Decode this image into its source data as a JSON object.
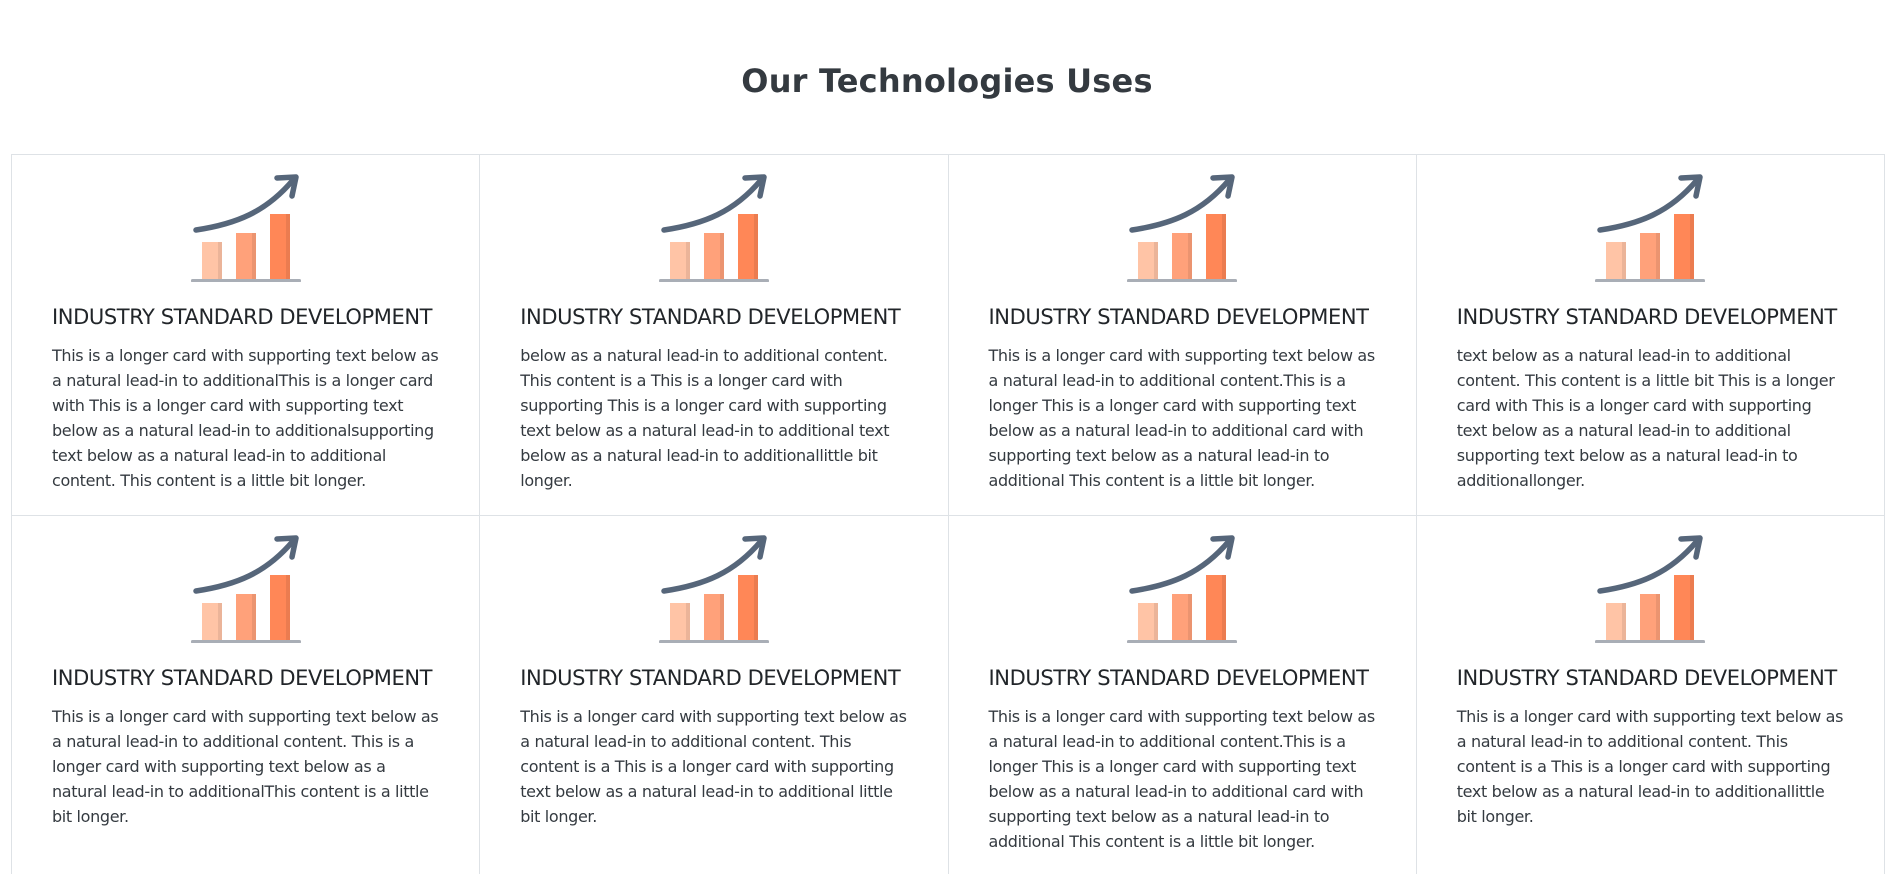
{
  "section": {
    "title": "Our Technologies Uses"
  },
  "icon": {
    "name": "growth-chart-icon",
    "arrow_color": "#56667a",
    "bar_colors": [
      "#ffc4a6",
      "#ffa17a",
      "#ff8757"
    ],
    "base_color": "#a9aeb6"
  },
  "cards": [
    {
      "title": "INDUSTRY STANDARD DEVELOPMENT",
      "text": "This is a longer card with supporting text below as a natural lead-in to additionalThis is a longer card with This is a longer card with supporting text below as a natural lead-in to additionalsupporting text below as a natural lead-in to additional content. This content is a little bit longer."
    },
    {
      "title": "INDUSTRY STANDARD DEVELOPMENT",
      "text": "below as a natural lead-in to additional content. This content is a This is a longer card with supporting This is a longer card with supporting text below as a natural lead-in to additional text below as a natural lead-in to additionallittle bit longer."
    },
    {
      "title": "INDUSTRY STANDARD DEVELOPMENT",
      "text": "This is a longer card with supporting text below as a natural lead-in to additional content.This is a longer This is a longer card with supporting text below as a natural lead-in to additional card with supporting text below as a natural lead-in to additional This content is a little bit longer."
    },
    {
      "title": "INDUSTRY STANDARD DEVELOPMENT",
      "text": "text below as a natural lead-in to additional content. This content is a little bit This is a longer card with This is a longer card with supporting text below as a natural lead-in to additional supporting text below as a natural lead-in to additionallonger."
    },
    {
      "title": "INDUSTRY STANDARD DEVELOPMENT",
      "text": "This is a longer card with supporting text below as a natural lead-in to additional content. This is a longer card with supporting text below as a natural lead-in to additionalThis content is a little bit longer."
    },
    {
      "title": "INDUSTRY STANDARD DEVELOPMENT",
      "text": "This is a longer card with supporting text below as a natural lead-in to additional content. This content is a This is a longer card with supporting text below as a natural lead-in to additional little bit longer."
    },
    {
      "title": "INDUSTRY STANDARD DEVELOPMENT",
      "text": "This is a longer card with supporting text below as a natural lead-in to additional content.This is a longer This is a longer card with supporting text below as a natural lead-in to additional card with supporting text below as a natural lead-in to additional This content is a little bit longer."
    },
    {
      "title": "INDUSTRY STANDARD DEVELOPMENT",
      "text": "This is a longer card with supporting text below as a natural lead-in to additional content. This content is a This is a longer card with supporting text below as a natural lead-in to additionallittle bit longer."
    }
  ]
}
